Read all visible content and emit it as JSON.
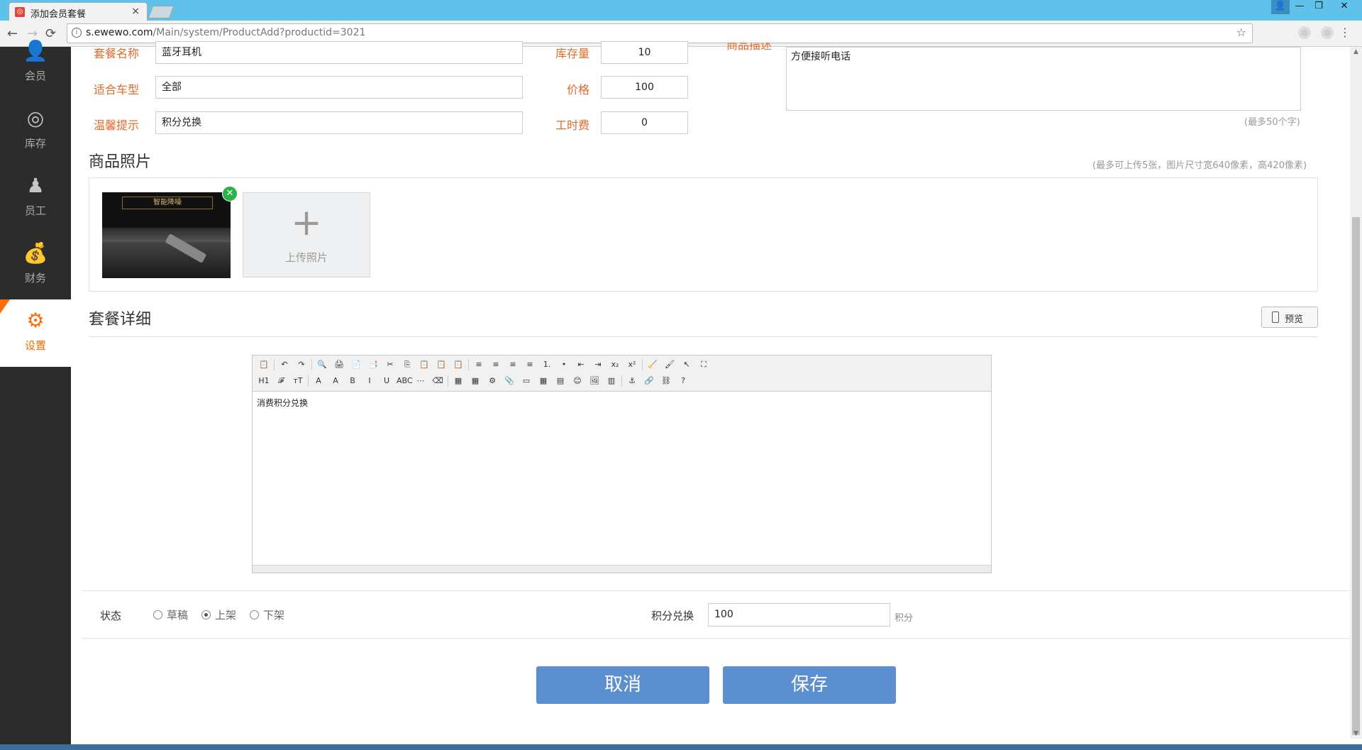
{
  "browser": {
    "tab_title": "添加会员套餐",
    "tab_close": "×",
    "url_host": "s.ewewo.com",
    "url_path": "/Main/system/ProductAdd?productid=3021",
    "nav": {
      "back": "←",
      "forward": "→",
      "reload": "⟳"
    },
    "star": "☆",
    "menu": "⋮",
    "window_controls": {
      "user": "👤",
      "minimize": "—",
      "restore": "❐",
      "close": "✕"
    }
  },
  "sidebar": {
    "items": [
      {
        "label": "会员",
        "icon": "member-icon",
        "glyph": "👤"
      },
      {
        "label": "库存",
        "icon": "inventory-target-icon",
        "glyph": "◎"
      },
      {
        "label": "员工",
        "icon": "staff-icon",
        "glyph": "♟"
      },
      {
        "label": "财务",
        "icon": "finance-icon",
        "glyph": "💰"
      },
      {
        "label": "设置",
        "icon": "settings-gear-icon",
        "glyph": "⚙",
        "active": true
      }
    ]
  },
  "form": {
    "package_name": {
      "label": "套餐名称",
      "value": "蓝牙耳机"
    },
    "vehicle_type": {
      "label": "适合车型",
      "value": "全部"
    },
    "tip": {
      "label": "温馨提示",
      "value": "积分兑换"
    },
    "stock": {
      "label": "库存量",
      "value": "10"
    },
    "price": {
      "label": "价格",
      "value": "100"
    },
    "labor_fee": {
      "label": "工时费",
      "value": "0"
    },
    "description": {
      "label": "商品描述",
      "value": "方便接听电话",
      "hint": "(最多50个字)"
    }
  },
  "photos": {
    "title": "商品照片",
    "hint": "(最多可上传5张，图片尺寸宽640像素，高420像素)",
    "thumb_caption": "智能降噪",
    "remove_glyph": "✕",
    "upload_plus": "+",
    "upload_label": "上传照片"
  },
  "details": {
    "title": "套餐详细",
    "preview_label": "预览",
    "editor_content": "消费积分兑换",
    "toolbar_row1": [
      "📋",
      "↶",
      "↷",
      "🔍",
      "🖨",
      "📄",
      "📑",
      "✂",
      "⎘",
      "📋",
      "📋",
      "📋",
      "≡",
      "≡",
      "≡",
      "≡",
      "1.",
      "•",
      "⇤",
      "⇥",
      "x₂",
      "x²",
      "🧹",
      "🖌",
      "↖",
      "⛶"
    ],
    "toolbar_row2": [
      "H1",
      "𝓕",
      "тТ",
      "A",
      "A",
      "B",
      "I",
      "U",
      "ABC",
      "⋯",
      "⌫",
      "▦",
      "▦",
      "⚙",
      "📎",
      "▭",
      "▦",
      "▤",
      "😊",
      "🖼",
      "▥",
      "⚓",
      "🔗",
      "⛓",
      "?"
    ]
  },
  "status": {
    "label": "状态",
    "options": [
      {
        "label": "草稿",
        "checked": false
      },
      {
        "label": "上架",
        "checked": true
      },
      {
        "label": "下架",
        "checked": false
      }
    ],
    "points_label": "积分兑换",
    "points_value": "100",
    "points_unit": "积分"
  },
  "actions": {
    "cancel": "取消",
    "save": "保存"
  },
  "colors": {
    "accent": "#ff6c00",
    "label": "#e06a2a",
    "button": "#5b8fcf",
    "sidebar": "#2c2c2c",
    "titlebar": "#5fc2ea"
  }
}
